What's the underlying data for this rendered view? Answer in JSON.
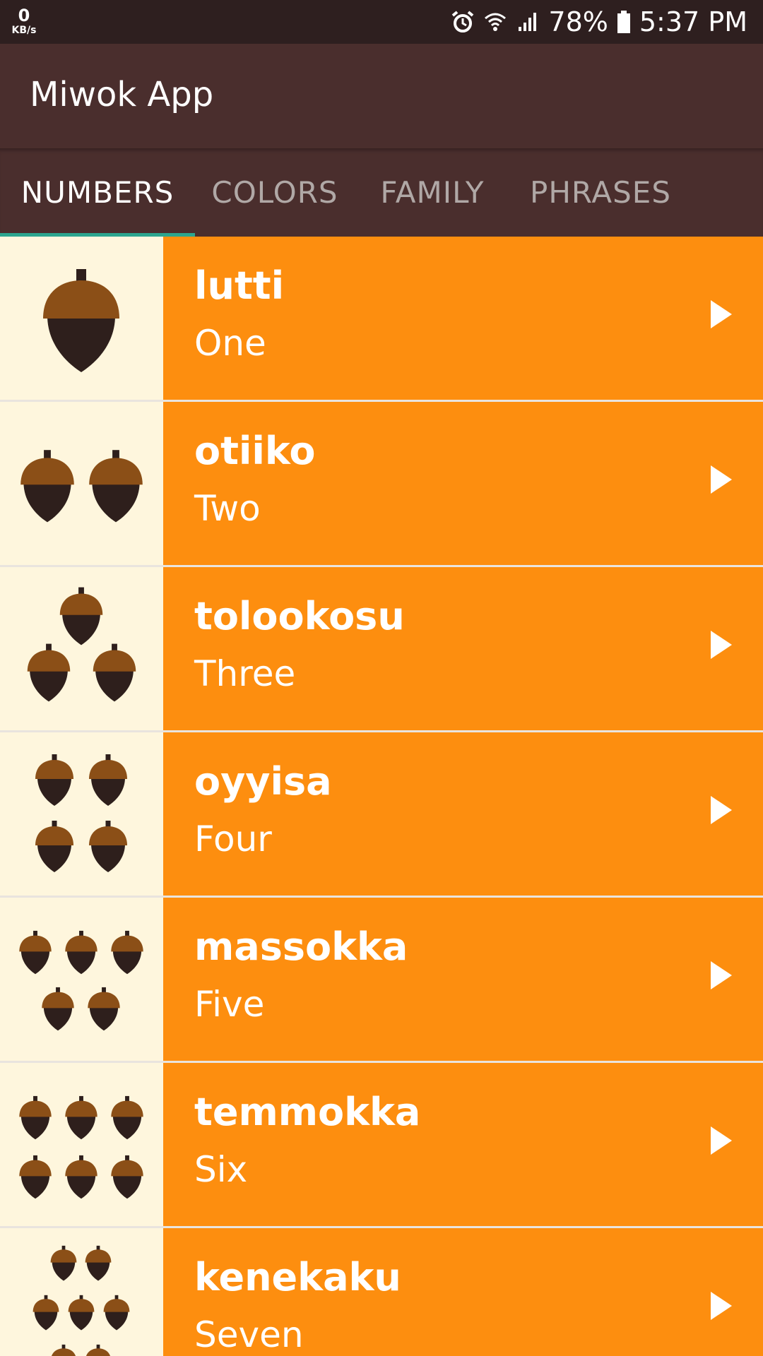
{
  "status_bar": {
    "net_speed": "0",
    "net_unit": "KB/s",
    "battery": "78%",
    "time": "5:37 PM",
    "icons": [
      "alarm-icon",
      "wifi-icon",
      "signal-icon",
      "battery-icon"
    ]
  },
  "app_bar": {
    "title": "Miwok App"
  },
  "tabs": [
    {
      "label": "NUMBERS",
      "active": true
    },
    {
      "label": "COLORS",
      "active": false
    },
    {
      "label": "FAMILY",
      "active": false
    },
    {
      "label": "PHRASES",
      "active": false
    }
  ],
  "colors": {
    "status_bar": "#2E1F1F",
    "app_bar": "#4A2E2D",
    "tab_indicator": "#2BA68F",
    "row_background": "#FD8E0F",
    "image_background": "#FEF6DD",
    "acorn_cap": "#8B4F17",
    "acorn_body": "#2E1F1C"
  },
  "words": [
    {
      "miwok": "lutti",
      "english": "One",
      "acorn_count": 1
    },
    {
      "miwok": "otiiko",
      "english": "Two",
      "acorn_count": 2
    },
    {
      "miwok": "tolookosu",
      "english": "Three",
      "acorn_count": 3
    },
    {
      "miwok": "oyyisa",
      "english": "Four",
      "acorn_count": 4
    },
    {
      "miwok": "massokka",
      "english": "Five",
      "acorn_count": 5
    },
    {
      "miwok": "temmokka",
      "english": "Six",
      "acorn_count": 6
    },
    {
      "miwok": "kenekaku",
      "english": "Seven",
      "acorn_count": 7
    }
  ]
}
